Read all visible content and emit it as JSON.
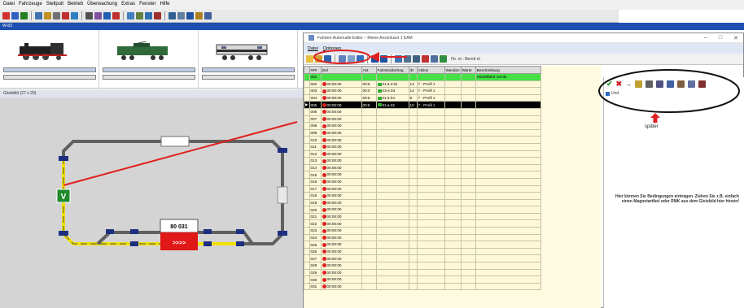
{
  "main_menu": [
    "Datei",
    "Fahrzeuge",
    "Stellpult",
    "Betrieb",
    "Überwachung",
    "Extras",
    "Fenster",
    "Hilfe"
  ],
  "blue_strip_label": "W-83",
  "layout_title": "Gleisbild (27 x 20)",
  "dialog": {
    "title": "Fahrten-Automatik-Editor – Meine Anschlusst 1 EAM",
    "menu": [
      "Datei",
      "Optionen"
    ],
    "toolbar_label": "Fb. nt - Bereit nt",
    "columns": [
      "###",
      "Ziel",
      "Akt.",
      "Fahrstraße/Seg.",
      "ID",
      "Aktion",
      "Wenden",
      "Warte",
      "Beschreibung"
    ],
    "rows": [
      {
        "no": "001",
        "ziel": "",
        "akt": "",
        "fahr": "",
        "id": "",
        "aktion": "",
        "beschr": "Abstellfahrt rechts",
        "type": "green"
      },
      {
        "no": "002",
        "ziel": "00:00:00",
        "akt": "00:6",
        "fahr": "01.6:4:01",
        "id": "13",
        "aktion": "7 - Profil 1",
        "beschr": "",
        "type": "normal"
      },
      {
        "no": "003",
        "ziel": "00:00:00",
        "akt": "00:0",
        "fahr": "03-4:03",
        "id": "14",
        "aktion": "7 - Profil 1",
        "beschr": "",
        "type": "normal"
      },
      {
        "no": "004",
        "ziel": "00:00:00",
        "akt": "00:5",
        "fahr": "01.5:04",
        "id": "8",
        "aktion": "7 - Profil 1",
        "beschr": "",
        "type": "normal"
      },
      {
        "no": "005",
        "ziel": "00:00:00",
        "akt": "00:6",
        "fahr": "01:a-01",
        "id": "10",
        "aktion": "7 - Profil 1",
        "beschr": "",
        "type": "selected"
      },
      {
        "no": "006",
        "ziel": "00:00:00",
        "type": "beige"
      },
      {
        "no": "007",
        "ziel": "00:00:00",
        "type": "beige"
      },
      {
        "no": "008",
        "ziel": "00:00:00",
        "type": "beige"
      },
      {
        "no": "009",
        "ziel": "00:00:00",
        "type": "beige"
      },
      {
        "no": "010",
        "ziel": "00:00:00",
        "type": "beige"
      },
      {
        "no": "011",
        "ziel": "00:00:00",
        "type": "beige"
      },
      {
        "no": "012",
        "ziel": "00:00:00",
        "type": "beige"
      },
      {
        "no": "013",
        "ziel": "00:00:00",
        "type": "beige"
      },
      {
        "no": "014",
        "ziel": "00:00:00",
        "type": "beige"
      },
      {
        "no": "015",
        "ziel": "00:00:00",
        "type": "beige"
      },
      {
        "no": "016",
        "ziel": "00:00:00",
        "type": "beige"
      },
      {
        "no": "017",
        "ziel": "00:00:00",
        "type": "beige"
      },
      {
        "no": "018",
        "ziel": "00:00:00",
        "type": "beige"
      },
      {
        "no": "019",
        "ziel": "00:00:00",
        "type": "beige"
      },
      {
        "no": "020",
        "ziel": "00:00:00",
        "type": "beige"
      },
      {
        "no": "021",
        "ziel": "00:00:00",
        "type": "beige"
      },
      {
        "no": "022",
        "ziel": "00:00:00",
        "type": "beige"
      },
      {
        "no": "023",
        "ziel": "00:00:00",
        "type": "beige"
      },
      {
        "no": "024",
        "ziel": "00:00:00",
        "type": "beige"
      },
      {
        "no": "025",
        "ziel": "00:00:00",
        "type": "beige"
      },
      {
        "no": "026",
        "ziel": "00:00:00",
        "type": "beige"
      },
      {
        "no": "027",
        "ziel": "00:00:00",
        "type": "beige"
      },
      {
        "no": "028",
        "ziel": "00:00:00",
        "type": "beige"
      },
      {
        "no": "029",
        "ziel": "00:00:00",
        "type": "beige"
      },
      {
        "no": "030",
        "ziel": "00:00:00",
        "type": "beige"
      },
      {
        "no": "031",
        "ziel": "00:00:00",
        "type": "beige"
      }
    ],
    "side_tree_label": "Und",
    "side_note": "später",
    "side_info": "Hier können Sie Bedingungen eintragen. Ziehen Sie z.B. einfach einen Magnetartikel oder RMK aus dem Gleisbild hier hinein!"
  },
  "layout": {
    "signal_label": "V",
    "train_number": "80 031",
    "train_arrows": ">>>>"
  },
  "colors": {
    "selection_green": "#44e044",
    "annotation_red": "#e02020",
    "track_yellow": "#f0e000",
    "track_grey": "#606060"
  }
}
